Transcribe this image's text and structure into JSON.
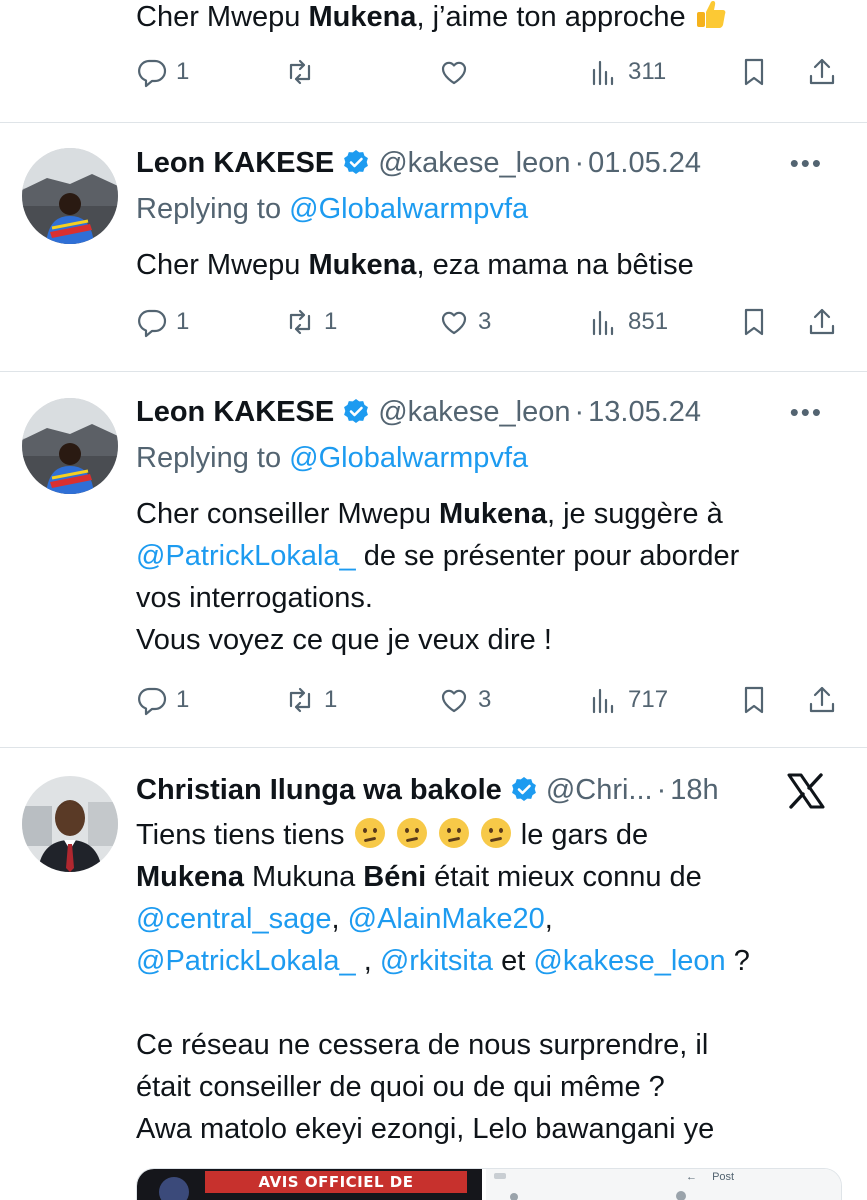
{
  "tweet0": {
    "text_pre": "Cher Mwepu ",
    "text_bold": "Mukena",
    "text_post": ", j’aime ton approche",
    "emoji": "thumbs-up",
    "replies": "1",
    "retweets": "",
    "likes": "",
    "views": "311"
  },
  "tweet1": {
    "name": "Leon KAKESE",
    "handle": "@kakese_leon",
    "separator": "·",
    "date": "01.05.24",
    "replying_prefix": "Replying to ",
    "replying_to": "@Globalwarmpvfa",
    "text_pre": "Cher Mwepu ",
    "text_bold": "Mukena",
    "text_post": ", eza mama na bêtise",
    "replies": "1",
    "retweets": "1",
    "likes": "3",
    "views": "851"
  },
  "tweet2": {
    "name": "Leon KAKESE",
    "handle": "@kakese_leon",
    "separator": "·",
    "date": "13.05.24",
    "replying_prefix": "Replying to ",
    "replying_to": "@Globalwarmpvfa",
    "line1_pre": "Cher conseiller Mwepu ",
    "line1_bold": "Mukena",
    "line1_post": ", je suggère à",
    "line2_mention": "@PatrickLokala_",
    "line2_post": " de se présenter pour aborder",
    "line3": "vos interrogations.",
    "line4": "Vous voyez ce que je veux dire !",
    "replies": "1",
    "retweets": "1",
    "likes": "3",
    "views": "717"
  },
  "tweet3": {
    "name": "Christian Ilunga wa bakole",
    "handle": "@Chri...",
    "separator": "·",
    "date": "18h",
    "line1_pre": "Tiens tiens tiens ",
    "line1_post": " le gars de",
    "line2_bold1": "Mukena",
    "line2_mid": " Mukuna ",
    "line2_bold2": "Béni",
    "line2_post": " était mieux connu de",
    "line3_m1": "@central_sage",
    "line3_sep": ", ",
    "line3_m2": "@AlainMake20",
    "line3_end": ",",
    "line4_m1": "@PatrickLokala_",
    "line4_sep1": " , ",
    "line4_m2": "@rkitsita",
    "line4_sep2": " et ",
    "line4_m3": "@kakese_leon",
    "line4_end": " ?",
    "line5": "Ce réseau ne cessera de nous surprendre, il",
    "line6": "était conseiller de quoi ou de qui même ?",
    "line7": "Awa matolo ekeyi ezongi, Lelo bawangani ye",
    "media_caption": "AVIS OFFICIEL DE RECHERCHE",
    "media_post_label": "Post"
  },
  "colors": {
    "accent": "#1d9bf0",
    "muted": "#536471",
    "text": "#0f1419"
  }
}
